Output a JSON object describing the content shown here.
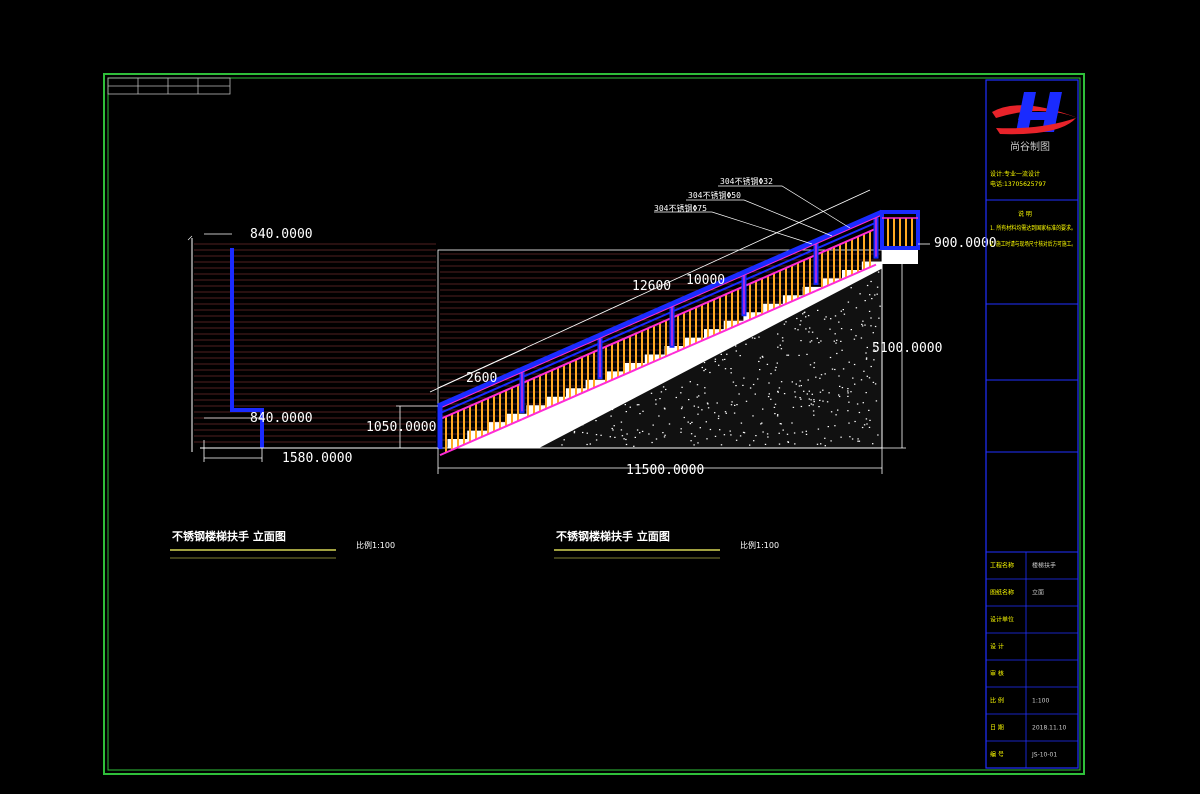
{
  "colors": {
    "frame": "#2fbf3a",
    "rail": "#1a2bff",
    "post": "#ff2bd6",
    "baluster": "#ffaa22",
    "dimension": "#ffffff",
    "hatch": "#6b2a2a",
    "titleblock": "#2030ff",
    "titleblock_text": "#ffff00",
    "logo_red": "#e8232a"
  },
  "dimensions": {
    "left_top": "840.0000",
    "left_bottom": "840.0000",
    "left_width": "1580.0000",
    "height_1050": "1050.0000",
    "length_2600": "2600",
    "length_12600": "12600",
    "length_10000": "10000",
    "height_5100": "5100.0000",
    "height_900": "900.0000",
    "total_length": "11500.0000"
  },
  "leaders": {
    "label_1": "304不锈钢Φ32",
    "label_2": "304不锈钢Φ50",
    "label_3": "304不锈钢Φ75"
  },
  "captions": {
    "side_view_title": "不锈钢楼梯扶手 立面图",
    "side_view_scale": "比例1:100",
    "front_view_title": "不锈钢楼梯扶手 立面图",
    "front_view_scale": "比例1:100"
  },
  "titleblock": {
    "company": "尚谷制图",
    "contact_line1": "设计:专业一流设计",
    "contact_line2": "电话:13705625797",
    "notes_heading": "说 明",
    "note_1": "1. 所有材料均需达到国家标准的要求。",
    "note_2": "2. 施工时请与现场尺寸核对后方可施工。",
    "row_labels": [
      "工程名称",
      "图纸名称",
      "设计单位",
      "设 计",
      "审 核",
      "比 例",
      "日 期",
      "编 号"
    ],
    "row_values": [
      "楼梯扶手",
      "立面",
      "",
      "",
      "",
      "1:100",
      "2018.11.10",
      "JS-10-01"
    ]
  }
}
